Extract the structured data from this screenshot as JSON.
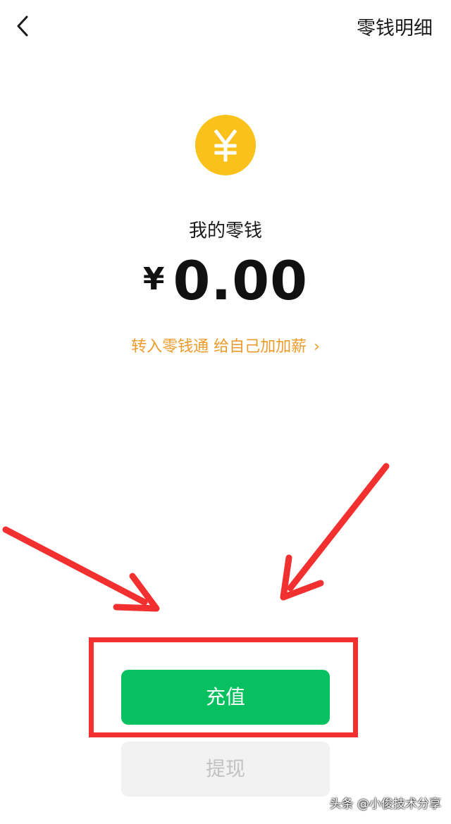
{
  "header": {
    "detail_label": "零钱明细"
  },
  "coin": {
    "symbol": "¥",
    "color": "#fbc11b"
  },
  "balance": {
    "label": "我的零钱",
    "currency": "¥",
    "amount": "0.00"
  },
  "promo": {
    "text": "转入零钱通 给自己加加薪",
    "chevron": "›",
    "color": "#ee9b2c"
  },
  "actions": {
    "recharge_label": "充值",
    "recharge_color": "#07c160",
    "withdraw_label": "提现"
  },
  "watermark": "头条 @小俊技术分享",
  "annotation": {
    "color": "#f23030"
  }
}
